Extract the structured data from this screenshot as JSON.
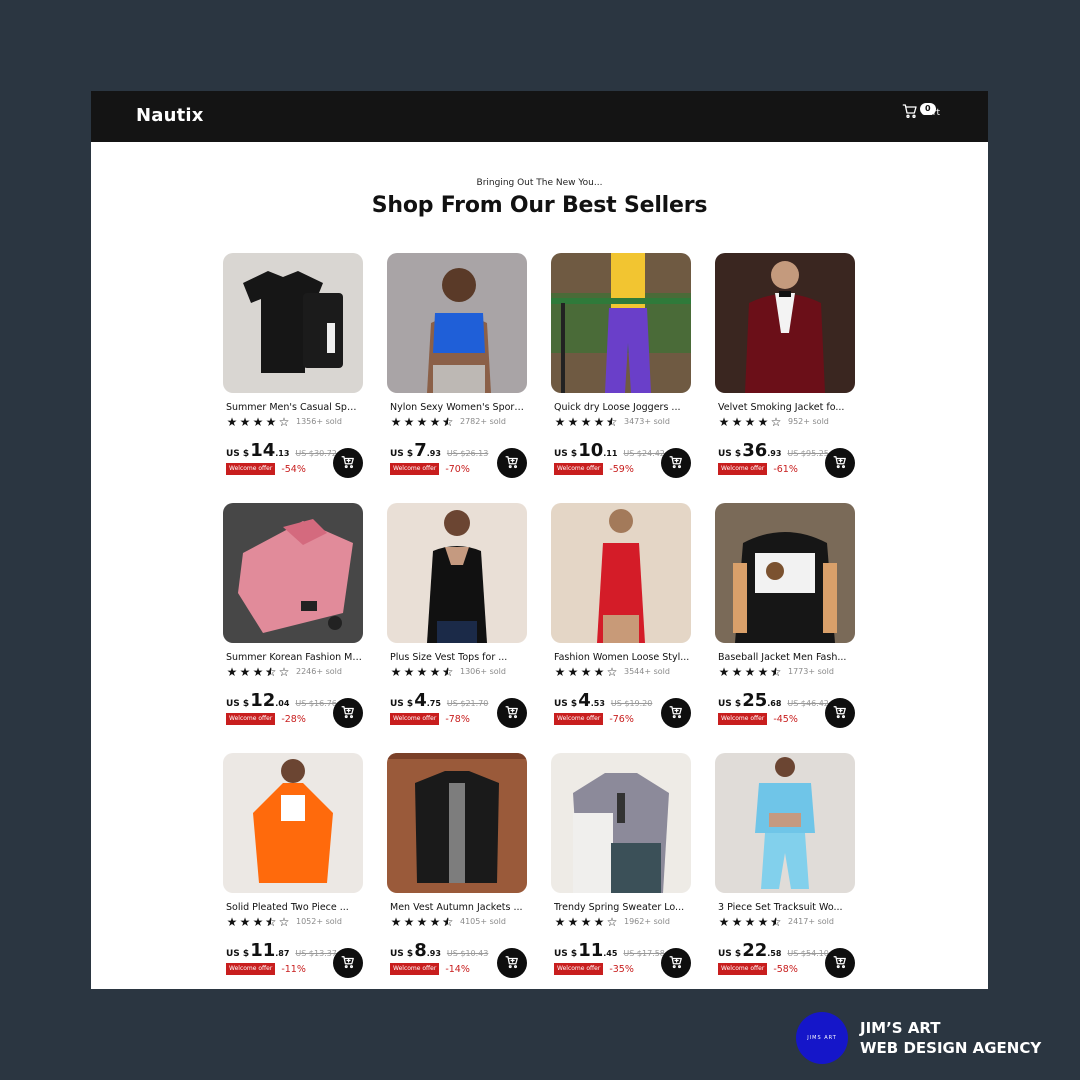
{
  "nav": {
    "brand": "Nautix",
    "cart_count": "0",
    "cart_label": "Cart"
  },
  "hero": {
    "eyebrow": "Bringing Out The New You...",
    "heading": "Shop From Our Best Sellers"
  },
  "offer_label": "Welcome offer",
  "currency": "US $",
  "colors": {
    "nav_bg": "#141414",
    "discount_red": "#c81e1e",
    "page_bg": "#2b3641",
    "agency_blue": "#1516c9"
  },
  "products": [
    {
      "title": "Summer Men's Casual Sport...",
      "rating": 4,
      "sold": "1356+ sold",
      "price_whole": "14",
      "price_cents": ".13",
      "old_price": "US $30.72",
      "discount": "-54%"
    },
    {
      "title": "Nylon Sexy Women's Sport...",
      "rating": 4.5,
      "sold": "2782+ sold",
      "price_whole": "7",
      "price_cents": ".93",
      "old_price": "US $26.13",
      "discount": "-70%"
    },
    {
      "title": "Quick dry Loose Joggers ...",
      "rating": 4.5,
      "sold": "3473+ sold",
      "price_whole": "10",
      "price_cents": ".11",
      "old_price": "US $24.42",
      "discount": "-59%"
    },
    {
      "title": "Velvet Smoking Jacket fo...",
      "rating": 4,
      "sold": "952+ sold",
      "price_whole": "36",
      "price_cents": ".93",
      "old_price": "US $95.25",
      "discount": "-61%"
    },
    {
      "title": "Summer Korean Fashion Me...",
      "rating": 3.5,
      "sold": "2246+ sold",
      "price_whole": "12",
      "price_cents": ".04",
      "old_price": "US $16.76",
      "discount": "-28%"
    },
    {
      "title": "Plus Size Vest Tops for ...",
      "rating": 4.5,
      "sold": "1306+ sold",
      "price_whole": "4",
      "price_cents": ".75",
      "old_price": "US $21.70",
      "discount": "-78%"
    },
    {
      "title": "Fashion Women Loose Styl...",
      "rating": 4,
      "sold": "3544+ sold",
      "price_whole": "4",
      "price_cents": ".53",
      "old_price": "US $19.20",
      "discount": "-76%"
    },
    {
      "title": "Baseball Jacket Men Fash...",
      "rating": 4.5,
      "sold": "1773+ sold",
      "price_whole": "25",
      "price_cents": ".68",
      "old_price": "US $46.42",
      "discount": "-45%"
    },
    {
      "title": "Solid Pleated Two Piece ...",
      "rating": 3.5,
      "sold": "1052+ sold",
      "price_whole": "11",
      "price_cents": ".87",
      "old_price": "US $13.37",
      "discount": "-11%"
    },
    {
      "title": "Men Vest Autumn Jackets ...",
      "rating": 4.5,
      "sold": "4105+ sold",
      "price_whole": "8",
      "price_cents": ".93",
      "old_price": "US $10.43",
      "discount": "-14%"
    },
    {
      "title": "Trendy Spring Sweater Lo...",
      "rating": 4,
      "sold": "1962+ sold",
      "price_whole": "11",
      "price_cents": ".45",
      "old_price": "US $17.58",
      "discount": "-35%"
    },
    {
      "title": "3 Piece Set Tracksuit Wo...",
      "rating": 4.5,
      "sold": "2417+ sold",
      "price_whole": "22",
      "price_cents": ".58",
      "old_price": "US $54.10",
      "discount": "-58%"
    }
  ],
  "agency": {
    "logo_text": "JIMS ART",
    "line1": "JIM’S ART",
    "line2": "WEB DESIGN AGENCY"
  }
}
